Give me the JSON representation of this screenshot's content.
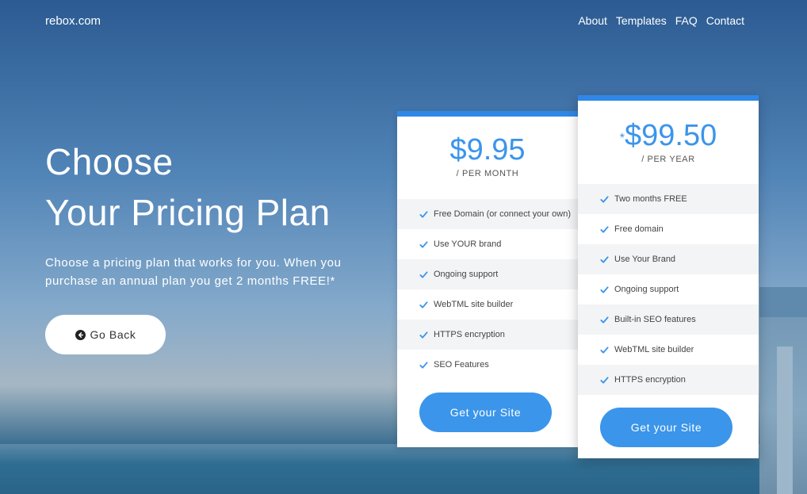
{
  "nav": {
    "brand": "rebox.com",
    "links": [
      "About",
      "Templates",
      "FAQ",
      "Contact"
    ]
  },
  "hero": {
    "title_line1": "Choose",
    "title_line2": "Your Pricing Plan",
    "text": "Choose a pricing plan that works for you. When you purchase an annual plan you get 2 months FREE!*",
    "back_label": "Go Back",
    "back_icon": "arrow-left-circle-icon"
  },
  "plans": [
    {
      "price": "$9.95",
      "period": "/ PER MONTH",
      "features": [
        "Free Domain (or connect your own)",
        "Use YOUR brand",
        "Ongoing support",
        "WebTML site builder",
        "HTTPS encryption",
        "SEO Features"
      ],
      "cta": "Get your Site"
    },
    {
      "price_star": "*",
      "price": "$99.50",
      "period": "/ PER YEAR",
      "features": [
        "Two months FREE",
        "Free domain",
        "Use Your Brand",
        "Ongoing support",
        "Built-in SEO features",
        "WebTML site builder",
        "HTTPS encryption"
      ],
      "cta": "Get your Site"
    }
  ],
  "colors": {
    "accent": "#3b95ea",
    "card_top_bar": "#2f87e8",
    "feature_stripe": "#f3f4f6"
  }
}
